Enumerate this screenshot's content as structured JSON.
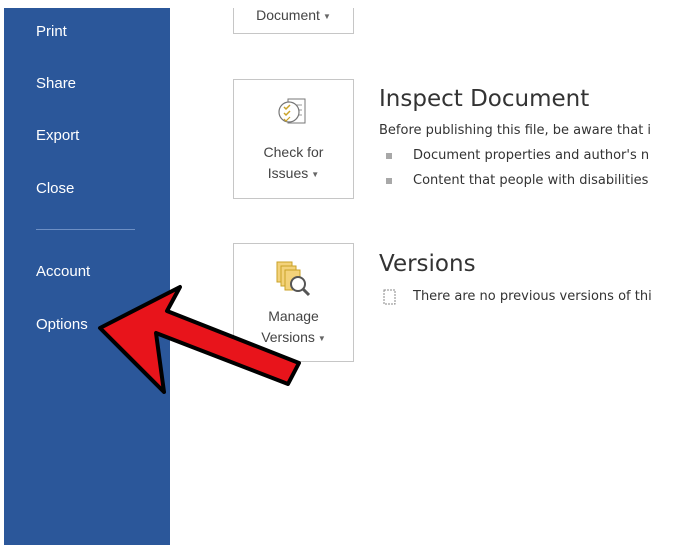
{
  "sidebar": {
    "items": [
      {
        "label": "Print"
      },
      {
        "label": "Share"
      },
      {
        "label": "Export"
      },
      {
        "label": "Close"
      },
      {
        "label": "Account"
      },
      {
        "label": "Options"
      }
    ]
  },
  "top_tile": {
    "label": "Document"
  },
  "inspect": {
    "tile_line1": "Check for",
    "tile_line2": "Issues",
    "heading": "Inspect Document",
    "intro": "Before publishing this file, be aware that i",
    "bullets": [
      "Document properties and author's n",
      "Content that people with disabilities"
    ]
  },
  "versions": {
    "tile_line1": "Manage",
    "tile_line2": "Versions",
    "heading": "Versions",
    "text": "There are no previous versions of thi"
  },
  "colors": {
    "sidebar": "#2B579A",
    "arrow": "#E8141B"
  },
  "icons": [
    "inspect-checklist-icon",
    "manage-versions-icon",
    "versions-doc-icon",
    "dropdown-caret-icon",
    "red-arrow-annotation"
  ]
}
